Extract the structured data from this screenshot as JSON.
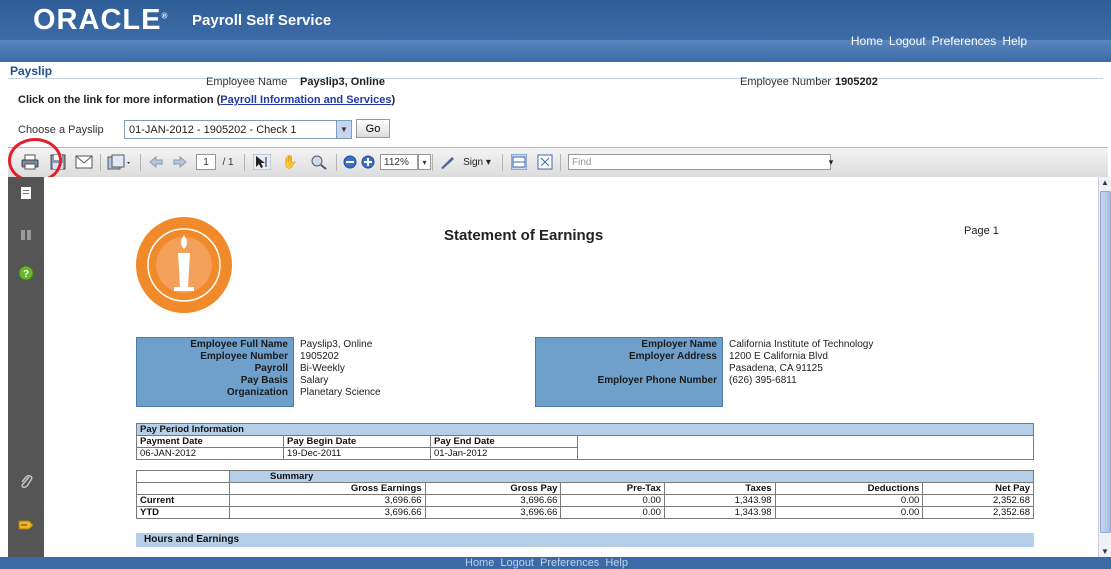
{
  "header": {
    "logo": "ORACLE",
    "app_title": "Payroll Self Service",
    "links": [
      "Home",
      "Logout",
      "Preferences",
      "Help"
    ]
  },
  "payslip": {
    "tab": "Payslip",
    "employee_name_label": "Employee Name",
    "employee_name": "Payslip3, Online",
    "employee_number_label": "Employee Number",
    "employee_number": "1905202",
    "info_text": "Click on the link for more information (",
    "info_link": "Payroll Information and Services",
    "info_close": ")",
    "choose_label": "Choose a Payslip",
    "choose_value": "01-JAN-2012 - 1905202 - Check 1",
    "go_label": "Go"
  },
  "pdf_toolbar": {
    "page_current": "1",
    "page_total": "/ 1",
    "zoom": "112%",
    "sign_label": "Sign",
    "find_placeholder": "Find"
  },
  "doc": {
    "title": "Statement of Earnings",
    "page": "Page 1",
    "employee_info": {
      "labels": [
        "Employee Full Name",
        "Employee Number",
        "Payroll",
        "Pay Basis",
        "Organization"
      ],
      "values": [
        "Payslip3, Online",
        "1905202",
        "Bi-Weekly",
        "Salary",
        "Planetary Science"
      ]
    },
    "employer_info": {
      "name_label": "Employer Name",
      "address_label": "Employer Address",
      "phone_label": "Employer Phone Number",
      "name": "California Institute of Technology",
      "address1": "1200 E California Blvd",
      "address2": "Pasadena, CA 91125",
      "phone": "(626) 395-6811"
    },
    "pay_period": {
      "heading": "Pay Period Information",
      "cols": [
        "Payment Date",
        "Pay Begin Date",
        "Pay End Date"
      ],
      "vals": [
        "06-JAN-2012",
        "19-Dec-2011",
        "01-Jan-2012"
      ]
    },
    "summary": {
      "heading": "Summary",
      "cols": [
        "Gross Earnings",
        "Gross Pay",
        "Pre-Tax",
        "Taxes",
        "Deductions",
        "Net Pay"
      ],
      "rows": [
        {
          "label": "Current",
          "vals": [
            "3,696.66",
            "3,696.66",
            "0.00",
            "1,343.98",
            "0.00",
            "2,352.68"
          ]
        },
        {
          "label": "YTD",
          "vals": [
            "3,696.66",
            "3,696.66",
            "0.00",
            "1,343.98",
            "0.00",
            "2,352.68"
          ]
        }
      ]
    },
    "hours_heading": "Hours and Earnings"
  },
  "colors": {
    "header_blue": "#3b6aa6",
    "label_box_blue": "#6fa0cc",
    "table_head_blue": "#b6cfe8",
    "print_highlight_red": "#e0202a"
  }
}
